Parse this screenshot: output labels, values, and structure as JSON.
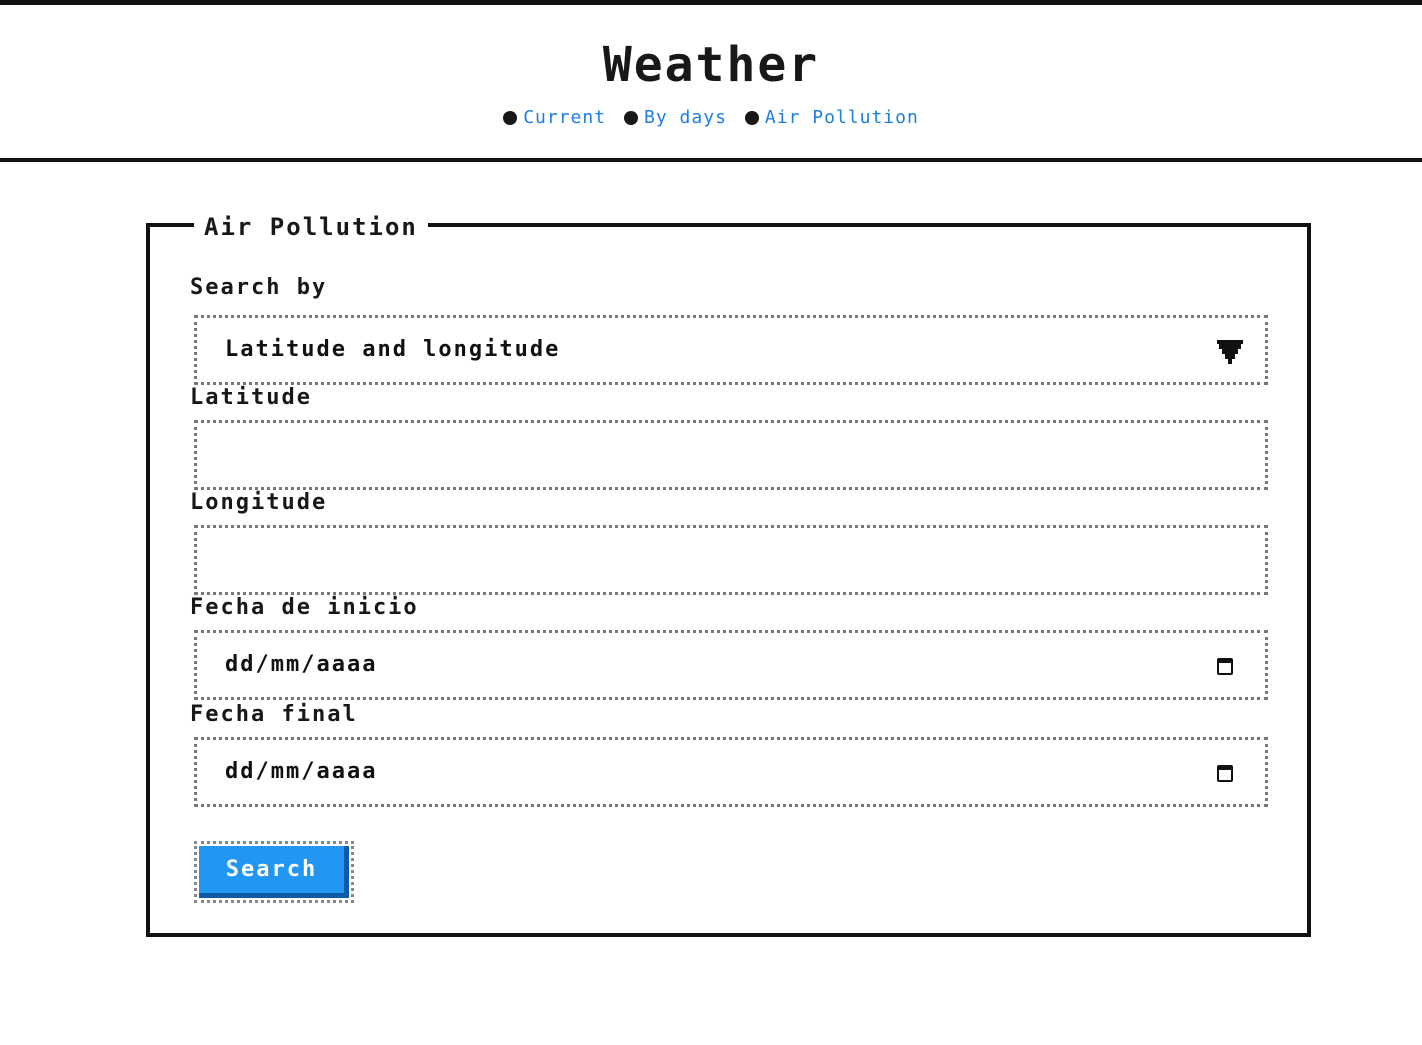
{
  "header": {
    "title": "Weather",
    "nav": [
      {
        "label": "Current",
        "icon": "bullet-icon"
      },
      {
        "label": "By days",
        "icon": "bullet-icon"
      },
      {
        "label": "Air Pollution",
        "icon": "bullet-icon"
      }
    ],
    "link_color": "#1e7fe0"
  },
  "form": {
    "legend": "Air Pollution",
    "search_by": {
      "label": "Search by",
      "selected": "Latitude and longitude",
      "icon": "chevron-down-icon"
    },
    "latitude": {
      "label": "Latitude",
      "value": ""
    },
    "longitude": {
      "label": "Longitude",
      "value": ""
    },
    "start_date": {
      "label": "Fecha de inicio",
      "placeholder": "dd/mm/aaaa",
      "icon": "calendar-icon"
    },
    "end_date": {
      "label": "Fecha final",
      "placeholder": "dd/mm/aaaa",
      "icon": "calendar-icon"
    },
    "submit_label": "Search",
    "button_color": "#2196f3"
  }
}
